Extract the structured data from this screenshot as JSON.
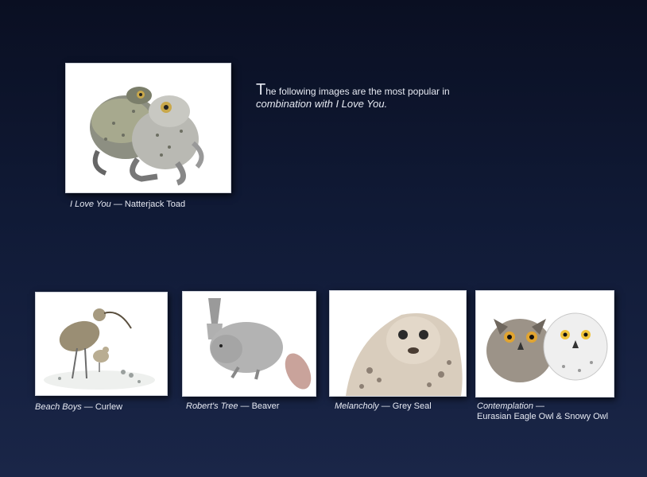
{
  "intro": {
    "first_letter": "T",
    "line1_rest": "he following images are the most popular  in",
    "line2": "combination with I Love You."
  },
  "featured": {
    "title": "I Love You",
    "subtitle": " — Natterjack Toad",
    "icon": "toads-illustration"
  },
  "gallery": [
    {
      "title": "Beach Boys",
      "subtitle": " — Curlew",
      "icon": "curlew-illustration"
    },
    {
      "title": "Robert's Tree",
      "subtitle": " — Beaver",
      "icon": "beaver-illustration"
    },
    {
      "title": "Melancholy",
      "subtitle": " — Grey Seal",
      "icon": "seal-illustration"
    },
    {
      "title": "Contemplation",
      "subtitle": " —",
      "line2": "Eurasian Eagle Owl & Snowy Owl",
      "icon": "owls-illustration"
    }
  ],
  "colors": {
    "background_top": "#0a0f22",
    "background_bottom": "#1a2648",
    "text": "#e6e9f2"
  }
}
